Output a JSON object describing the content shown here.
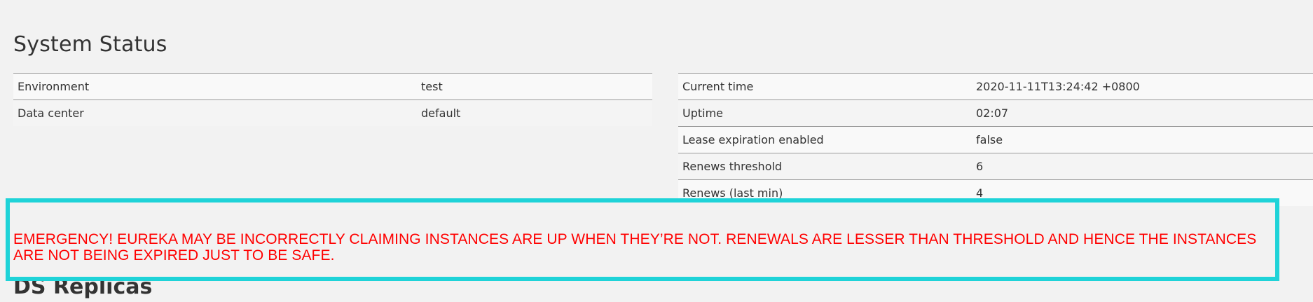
{
  "system_status": {
    "title": "System Status",
    "left_rows": [
      {
        "key": "Environment",
        "value": "test"
      },
      {
        "key": "Data center",
        "value": "default"
      }
    ],
    "right_rows": [
      {
        "key": "Current time",
        "value": "2020-11-11T13:24:42 +0800"
      },
      {
        "key": "Uptime",
        "value": "02:07"
      },
      {
        "key": "Lease expiration enabled",
        "value": "false"
      },
      {
        "key": "Renews threshold",
        "value": "6"
      },
      {
        "key": "Renews (last min)",
        "value": "4"
      }
    ]
  },
  "emergency": {
    "message": "EMERGENCY! EUREKA MAY BE INCORRECTLY CLAIMING INSTANCES ARE UP WHEN THEY’RE NOT. RENEWALS ARE LESSER THAN THRESHOLD AND HENCE THE INSTANCES ARE NOT BEING EXPIRED JUST TO BE SAFE.",
    "color": "#ff0000",
    "highlight_color": "#1fd3d8"
  },
  "ds_replicas": {
    "title": "DS Replicas"
  }
}
